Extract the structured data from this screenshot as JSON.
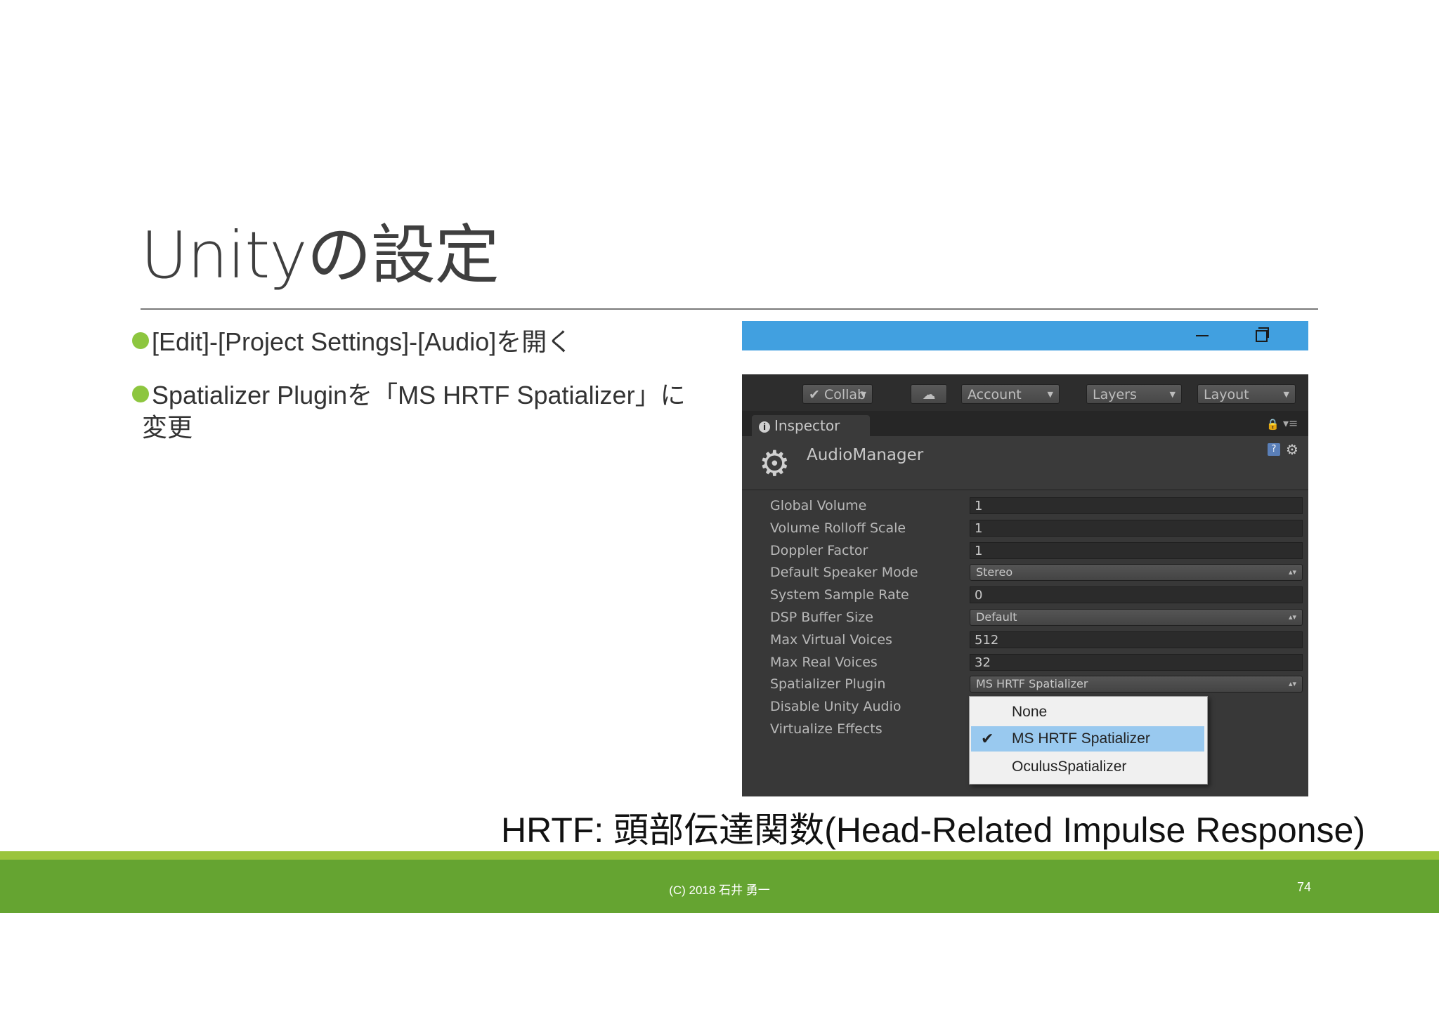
{
  "slide": {
    "title": "Unityの設定",
    "bullets": [
      "[Edit]-[Project Settings]-[Audio]を開く",
      "Spatializer Pluginを「MS HRTF Spatializer」に",
      "変更"
    ],
    "caption": "HRTF: 頭部伝達関数(Head-Related Impulse Response)",
    "footer": {
      "copyright": "(C) 2018 石井 勇一",
      "page": "74"
    },
    "colors": {
      "accent_green": "#65a431",
      "bullet_green": "#8dc63f",
      "window_titlebar": "#41a0e0"
    }
  },
  "window": {
    "titlebar_icons": [
      "minimize-icon",
      "restore-icon",
      "close-icon"
    ],
    "toolbar": {
      "collab": "Collab",
      "account": "Account",
      "layers": "Layers",
      "layout": "Layout"
    },
    "tab": {
      "label": "Inspector"
    },
    "header": {
      "title": "AudioManager"
    },
    "rows": [
      {
        "label": "Global Volume",
        "value": "1"
      },
      {
        "label": "Volume Rolloff Scale",
        "value": "1"
      },
      {
        "label": "Doppler Factor",
        "value": "1"
      },
      {
        "label": "Default Speaker Mode",
        "value": "Stereo"
      },
      {
        "label": "System Sample Rate",
        "value": "0"
      },
      {
        "label": "DSP Buffer Size",
        "value": "Default"
      },
      {
        "label": "Max Virtual Voices",
        "value": "512"
      },
      {
        "label": "Max Real Voices",
        "value": "32"
      },
      {
        "label": "Spatializer Plugin",
        "value": "MS HRTF Spatializer"
      },
      {
        "label": "Disable Unity Audio"
      },
      {
        "label": "Virtualize Effects"
      }
    ],
    "popup": {
      "options": [
        "None",
        "MS HRTF Spatializer",
        "OculusSpatializer"
      ],
      "selected": "MS HRTF Spatializer"
    }
  }
}
